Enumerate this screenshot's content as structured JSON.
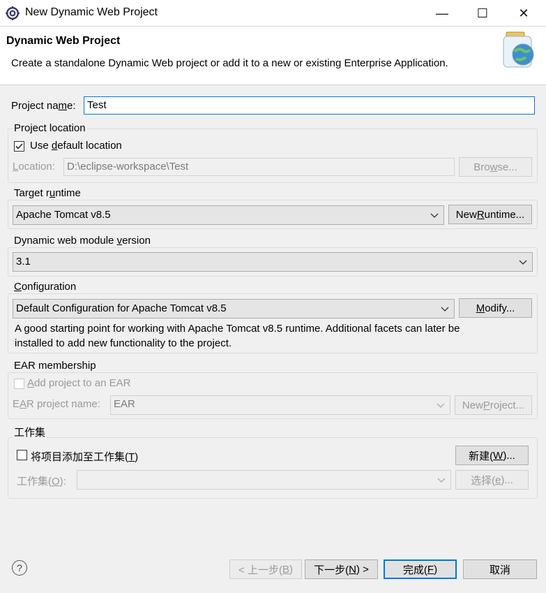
{
  "window": {
    "title": "New Dynamic Web Project",
    "minimize": "—",
    "maximize": "☐",
    "close": "✕"
  },
  "header": {
    "title": "Dynamic Web Project",
    "description": "Create a standalone Dynamic Web project or add it to a new or existing Enterprise Application."
  },
  "project_name": {
    "label_pre": "Project na",
    "label_mn": "m",
    "label_post": "e:",
    "value": "Test"
  },
  "location": {
    "group_label": "Project location",
    "use_default_pre": "Use ",
    "use_default_mn": "d",
    "use_default_post": "efault location",
    "use_default_checked": true,
    "label_mn": "L",
    "label_post": "ocation:",
    "value": "D:\\eclipse-workspace\\Test",
    "browse_pre": "Bro",
    "browse_mn": "w",
    "browse_post": "se..."
  },
  "runtime": {
    "group_label_pre": "Target r",
    "group_label_mn": "u",
    "group_label_post": "ntime",
    "value": "Apache Tomcat v8.5",
    "new_pre": "New ",
    "new_mn": "R",
    "new_post": "untime..."
  },
  "module": {
    "group_label_pre": "Dynamic web module ",
    "group_label_mn": "v",
    "group_label_post": "ersion",
    "value": "3.1"
  },
  "configuration": {
    "group_label_mn": "C",
    "group_label_post": "onfiguration",
    "value": "Default Configuration for Apache Tomcat v8.5",
    "modify_mn": "M",
    "modify_post": "odify...",
    "description_line1": "A good starting point for working with Apache Tomcat v8.5 runtime. Additional facets can later be",
    "description_line2": "installed to add new functionality to the project."
  },
  "ear": {
    "group_label": "EAR membership",
    "add_mn": "A",
    "add_post": "dd project to an EAR",
    "name_label_pre": "E",
    "name_label_mn": "A",
    "name_label_post": "R project name:",
    "name_value": "EAR",
    "new_project_pre": "New ",
    "new_project_mn": "P",
    "new_project_post": "roject..."
  },
  "working_set": {
    "group_label": "工作集",
    "add_pre": "将项目添加至工作集(",
    "add_mn": "T",
    "add_post": ")",
    "new_pre": "新建(",
    "new_mn": "W",
    "new_post": ")...",
    "sets_pre": "工作集(",
    "sets_mn": "O",
    "sets_post": "):",
    "select_pre": "选择(",
    "select_mn": "e",
    "select_post": ")..."
  },
  "footer": {
    "back_pre": "< 上一步(",
    "back_mn": "B",
    "back_post": ")",
    "next_pre": "下一步(",
    "next_mn": "N",
    "next_post": ") >",
    "finish_pre": "完成(",
    "finish_mn": "F",
    "finish_post": ")",
    "cancel": "取消",
    "help": "?"
  },
  "icons": {
    "app": "eclipse-icon",
    "banner": "web-project-banner-icon",
    "help": "help-icon"
  },
  "colors": {
    "focus": "#0078d7",
    "disabled_text": "#9a9a9a"
  }
}
